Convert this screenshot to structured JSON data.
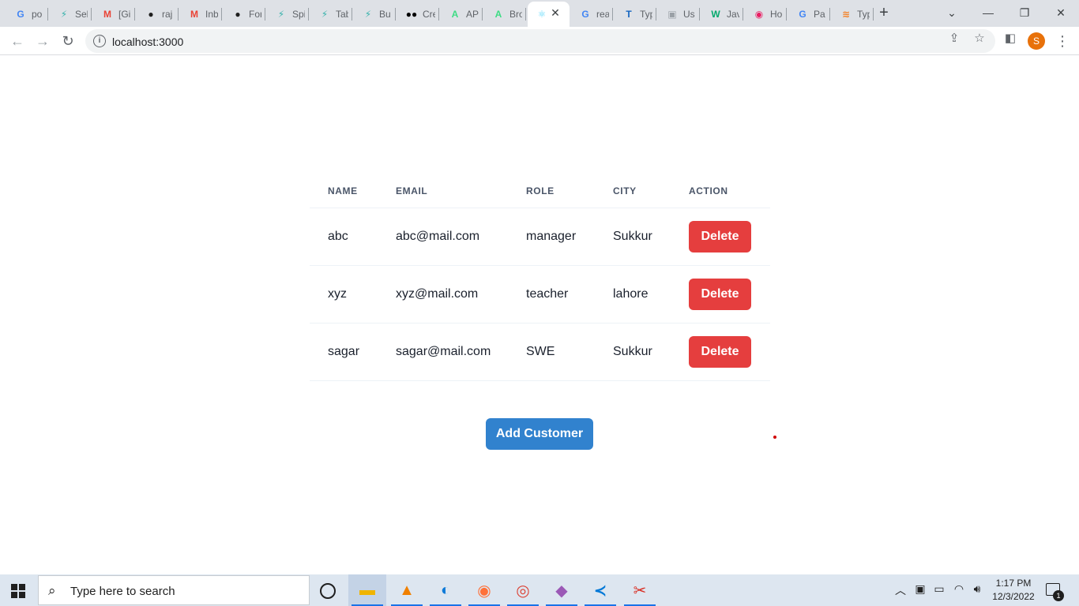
{
  "browser": {
    "tabs": [
      {
        "label": "po",
        "icon": "google-icon",
        "glyph": "G",
        "color": "#4285f4"
      },
      {
        "label": "Sel",
        "icon": "bolt-icon",
        "glyph": "⚡",
        "color": "#38b2ac"
      },
      {
        "label": "[Gi",
        "icon": "gmail-icon",
        "glyph": "M",
        "color": "#ea4335"
      },
      {
        "label": "raj",
        "icon": "github-icon",
        "glyph": "●",
        "color": "#1f1f1f"
      },
      {
        "label": "Inb",
        "icon": "gmail-icon",
        "glyph": "M",
        "color": "#ea4335"
      },
      {
        "label": "For",
        "icon": "github-icon",
        "glyph": "●",
        "color": "#1f1f1f"
      },
      {
        "label": "Spi",
        "icon": "bolt-icon",
        "glyph": "⚡",
        "color": "#38b2ac"
      },
      {
        "label": "Tab",
        "icon": "bolt-icon",
        "glyph": "⚡",
        "color": "#38b2ac"
      },
      {
        "label": "Bu",
        "icon": "bolt-icon",
        "glyph": "⚡",
        "color": "#38b2ac"
      },
      {
        "label": "Cre",
        "icon": "medium-icon",
        "glyph": "●●",
        "color": "#000000"
      },
      {
        "label": "AP",
        "icon": "android-studio-icon",
        "glyph": "A",
        "color": "#3ddc84"
      },
      {
        "label": "Bro",
        "icon": "android-studio-icon",
        "glyph": "A",
        "color": "#3ddc84"
      },
      {
        "label": "",
        "icon": "react-icon",
        "glyph": "⚛",
        "color": "#61dafb",
        "active": true
      },
      {
        "label": "rea",
        "icon": "google-icon",
        "glyph": "G",
        "color": "#4285f4"
      },
      {
        "label": "Typ",
        "icon": "typescript-icon",
        "glyph": "T",
        "color": "#1565c0"
      },
      {
        "label": "Us",
        "icon": "page-icon",
        "glyph": "▣",
        "color": "#9aa0a6"
      },
      {
        "label": "Jav",
        "icon": "w3-icon",
        "glyph": "W",
        "color": "#04aa6d"
      },
      {
        "label": "Ho",
        "icon": "record-icon",
        "glyph": "◉",
        "color": "#e91e63"
      },
      {
        "label": "Pa",
        "icon": "google-icon",
        "glyph": "G",
        "color": "#4285f4"
      },
      {
        "label": "Typ",
        "icon": "stackoverflow-icon",
        "glyph": "≋",
        "color": "#f48024"
      }
    ],
    "url": "localhost:3000",
    "profile_initial": "S",
    "profile_color": "#e8710a"
  },
  "table": {
    "headers": {
      "name": "NAME",
      "email": "EMAIL",
      "role": "ROLE",
      "city": "CITY",
      "action": "ACTION"
    },
    "rows": [
      {
        "name": "abc",
        "email": "abc@mail.com",
        "role": "manager",
        "city": "Sukkur",
        "action": "Delete"
      },
      {
        "name": "xyz",
        "email": "xyz@mail.com",
        "role": "teacher",
        "city": "lahore",
        "action": "Delete"
      },
      {
        "name": "sagar",
        "email": "sagar@mail.com",
        "role": "SWE",
        "city": "Sukkur",
        "action": "Delete"
      }
    ]
  },
  "add_button_label": "Add Customer",
  "colors": {
    "delete": "#e53e3e",
    "add": "#3182ce"
  },
  "taskbar": {
    "search_placeholder": "Type here to search",
    "time": "1:17 PM",
    "date": "12/3/2022",
    "notification_count": "1",
    "apps": [
      {
        "name": "file-explorer-icon",
        "glyph": "▬",
        "color": "#f0b400"
      },
      {
        "name": "vlc-icon",
        "glyph": "▲",
        "color": "#f08000"
      },
      {
        "name": "edge-icon",
        "glyph": "◐",
        "color": "#0f7bd8"
      },
      {
        "name": "firefox-icon",
        "glyph": "◉",
        "color": "#ff7139"
      },
      {
        "name": "chrome-icon",
        "glyph": "◎",
        "color": "#db4437"
      },
      {
        "name": "git-icon",
        "glyph": "◆",
        "color": "#9b59b6"
      },
      {
        "name": "vscode-icon",
        "glyph": "≺",
        "color": "#0078d7"
      },
      {
        "name": "snipping-tool-icon",
        "glyph": "✂",
        "color": "#d93025"
      }
    ]
  }
}
